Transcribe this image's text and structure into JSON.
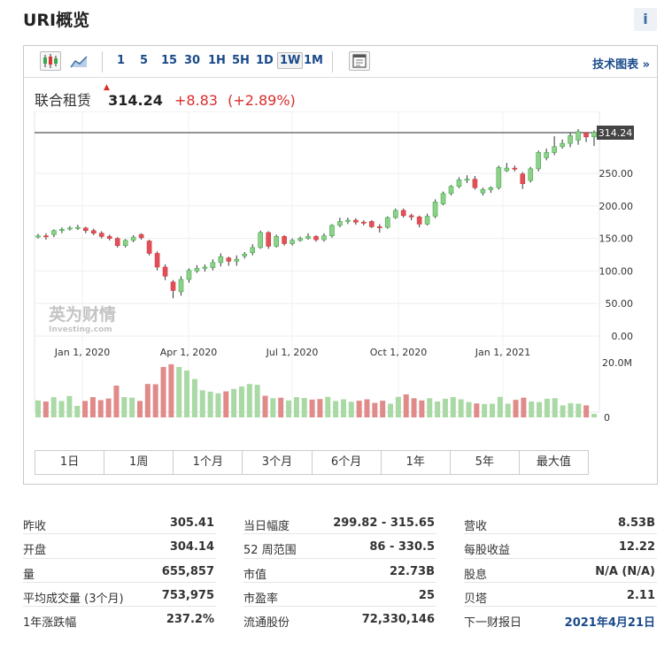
{
  "header": {
    "title": "URI概览",
    "info_icon": "i"
  },
  "toolbar": {
    "intervals": [
      "1",
      "5",
      "15",
      "30",
      "1H",
      "5H",
      "1D",
      "1W",
      "1M"
    ],
    "active_interval": "1W",
    "tech_chart_link": "技术图表 »"
  },
  "quote": {
    "name": "联合租赁",
    "price": "314.24",
    "change": "+8.83",
    "change_pct": "(+2.89%)"
  },
  "chart_data": {
    "type": "candlestick",
    "x_tick_labels": [
      "Jan 1, 2020",
      "Apr 1, 2020",
      "Jul 1, 2020",
      "Oct 1, 2020",
      "Jan 1, 2021"
    ],
    "y_tick_labels": [
      "250.00",
      "200.00",
      "150.00",
      "100.00",
      "50.00",
      "0.00"
    ],
    "ylim": [
      0,
      318
    ],
    "last_price_label": "314.24",
    "volume_axis_labels": [
      "20.0M",
      "0"
    ],
    "watermark": "英为财情 Investing.com",
    "colors": {
      "up": "#3fa94a",
      "down": "#d9383a",
      "up_fill": "#8fd18b",
      "down_fill": "#e0505a",
      "vol_up": "#a9d9a4",
      "vol_down": "#e08a8a"
    },
    "candles": [
      {
        "o": 152,
        "c": 154,
        "h": 157,
        "l": 150
      },
      {
        "o": 154,
        "c": 153,
        "h": 158,
        "l": 148
      },
      {
        "o": 156,
        "c": 162,
        "h": 164,
        "l": 152
      },
      {
        "o": 162,
        "c": 164,
        "h": 167,
        "l": 158
      },
      {
        "o": 165,
        "c": 166,
        "h": 169,
        "l": 162
      },
      {
        "o": 167,
        "c": 167,
        "h": 171,
        "l": 163
      },
      {
        "o": 166,
        "c": 162,
        "h": 168,
        "l": 158
      },
      {
        "o": 162,
        "c": 158,
        "h": 165,
        "l": 155
      },
      {
        "o": 158,
        "c": 153,
        "h": 161,
        "l": 150
      },
      {
        "o": 153,
        "c": 150,
        "h": 156,
        "l": 147
      },
      {
        "o": 150,
        "c": 139,
        "h": 152,
        "l": 136
      },
      {
        "o": 139,
        "c": 147,
        "h": 149,
        "l": 136
      },
      {
        "o": 147,
        "c": 152,
        "h": 155,
        "l": 144
      },
      {
        "o": 156,
        "c": 151,
        "h": 158,
        "l": 148
      },
      {
        "o": 146,
        "c": 127,
        "h": 148,
        "l": 124
      },
      {
        "o": 127,
        "c": 106,
        "h": 130,
        "l": 101
      },
      {
        "o": 106,
        "c": 92,
        "h": 110,
        "l": 86
      },
      {
        "o": 83,
        "c": 70,
        "h": 86,
        "l": 58
      },
      {
        "o": 68,
        "c": 87,
        "h": 92,
        "l": 62
      },
      {
        "o": 87,
        "c": 101,
        "h": 104,
        "l": 82
      },
      {
        "o": 100,
        "c": 104,
        "h": 109,
        "l": 97
      },
      {
        "o": 104,
        "c": 106,
        "h": 110,
        "l": 99
      },
      {
        "o": 105,
        "c": 113,
        "h": 118,
        "l": 101
      },
      {
        "o": 113,
        "c": 122,
        "h": 127,
        "l": 107
      },
      {
        "o": 120,
        "c": 115,
        "h": 122,
        "l": 108
      },
      {
        "o": 115,
        "c": 118,
        "h": 124,
        "l": 108
      },
      {
        "o": 123,
        "c": 126,
        "h": 129,
        "l": 119
      },
      {
        "o": 128,
        "c": 136,
        "h": 141,
        "l": 124
      },
      {
        "o": 136,
        "c": 159,
        "h": 162,
        "l": 134
      },
      {
        "o": 159,
        "c": 138,
        "h": 161,
        "l": 134
      },
      {
        "o": 138,
        "c": 153,
        "h": 156,
        "l": 136
      },
      {
        "o": 153,
        "c": 142,
        "h": 155,
        "l": 139
      },
      {
        "o": 142,
        "c": 147,
        "h": 150,
        "l": 139
      },
      {
        "o": 147,
        "c": 150,
        "h": 153,
        "l": 145
      },
      {
        "o": 150,
        "c": 153,
        "h": 158,
        "l": 148
      },
      {
        "o": 153,
        "c": 148,
        "h": 155,
        "l": 145
      },
      {
        "o": 148,
        "c": 154,
        "h": 158,
        "l": 145
      },
      {
        "o": 154,
        "c": 170,
        "h": 172,
        "l": 151
      },
      {
        "o": 170,
        "c": 176,
        "h": 182,
        "l": 167
      },
      {
        "o": 176,
        "c": 178,
        "h": 182,
        "l": 172
      },
      {
        "o": 178,
        "c": 175,
        "h": 181,
        "l": 171
      },
      {
        "o": 175,
        "c": 174,
        "h": 178,
        "l": 170
      },
      {
        "o": 176,
        "c": 168,
        "h": 178,
        "l": 166
      },
      {
        "o": 168,
        "c": 167,
        "h": 172,
        "l": 159
      },
      {
        "o": 167,
        "c": 182,
        "h": 184,
        "l": 165
      },
      {
        "o": 182,
        "c": 193,
        "h": 196,
        "l": 180
      },
      {
        "o": 193,
        "c": 185,
        "h": 196,
        "l": 182
      },
      {
        "o": 185,
        "c": 183,
        "h": 188,
        "l": 178
      },
      {
        "o": 183,
        "c": 172,
        "h": 185,
        "l": 167
      },
      {
        "o": 172,
        "c": 184,
        "h": 188,
        "l": 170
      },
      {
        "o": 184,
        "c": 206,
        "h": 210,
        "l": 181
      },
      {
        "o": 203,
        "c": 219,
        "h": 222,
        "l": 201
      },
      {
        "o": 219,
        "c": 230,
        "h": 232,
        "l": 216
      },
      {
        "o": 230,
        "c": 240,
        "h": 244,
        "l": 227
      },
      {
        "o": 240,
        "c": 241,
        "h": 247,
        "l": 235
      },
      {
        "o": 241,
        "c": 228,
        "h": 246,
        "l": 225
      },
      {
        "o": 220,
        "c": 225,
        "h": 228,
        "l": 216
      },
      {
        "o": 225,
        "c": 228,
        "h": 230,
        "l": 220
      },
      {
        "o": 228,
        "c": 259,
        "h": 262,
        "l": 225
      },
      {
        "o": 254,
        "c": 258,
        "h": 266,
        "l": 252
      },
      {
        "o": 258,
        "c": 257,
        "h": 262,
        "l": 253
      },
      {
        "o": 249,
        "c": 234,
        "h": 252,
        "l": 226
      },
      {
        "o": 239,
        "c": 257,
        "h": 260,
        "l": 236
      },
      {
        "o": 257,
        "c": 282,
        "h": 285,
        "l": 253
      },
      {
        "o": 274,
        "c": 282,
        "h": 288,
        "l": 270
      },
      {
        "o": 282,
        "c": 291,
        "h": 307,
        "l": 278
      },
      {
        "o": 291,
        "c": 296,
        "h": 302,
        "l": 288
      },
      {
        "o": 296,
        "c": 308,
        "h": 312,
        "l": 290
      },
      {
        "o": 301,
        "c": 314,
        "h": 318,
        "l": 294
      },
      {
        "o": 312,
        "c": 306,
        "h": 313,
        "l": 298
      },
      {
        "o": 306,
        "c": 313,
        "h": 316,
        "l": 292
      }
    ],
    "volumes": [
      6.2,
      5.8,
      7.4,
      6.0,
      7.8,
      4.2,
      6.0,
      7.4,
      6.3,
      6.9,
      11.6,
      7.4,
      7.2,
      6.0,
      12.2,
      12.1,
      18.4,
      19.4,
      18.4,
      17.1,
      14.0,
      9.9,
      9.4,
      8.8,
      9.5,
      10.4,
      11.3,
      12.2,
      11.9,
      7.9,
      7.0,
      7.2,
      6.2,
      7.4,
      7.1,
      6.5,
      6.7,
      7.5,
      6.0,
      6.6,
      5.7,
      6.1,
      6.6,
      5.3,
      6.1,
      5.0,
      7.5,
      8.4,
      7.0,
      6.2,
      7.0,
      5.8,
      6.8,
      7.4,
      6.6,
      5.6,
      5.1,
      4.9,
      5.0,
      7.5,
      5.0,
      6.4,
      7.2,
      5.8,
      5.6,
      6.8,
      7.0,
      4.4,
      5.2,
      5.0,
      4.4,
      1.3
    ]
  },
  "range_buttons": [
    "1日",
    "1周",
    "1个月",
    "3个月",
    "6个月",
    "1年",
    "5年",
    "最大值"
  ],
  "stats": {
    "col1": [
      {
        "label": "昨收",
        "value": "305.41"
      },
      {
        "label": "开盘",
        "value": "304.14"
      },
      {
        "label": "量",
        "value": "655,857"
      },
      {
        "label": "平均成交量 (3个月)",
        "value": "753,975"
      },
      {
        "label": "1年涨跌幅",
        "value": "237.2%"
      }
    ],
    "col2": [
      {
        "label": "当日幅度",
        "value": "299.82 - 315.65"
      },
      {
        "label": "52 周范围",
        "value": "86 - 330.5"
      },
      {
        "label": "市值",
        "value": "22.73B"
      },
      {
        "label": "市盈率",
        "value": "25"
      },
      {
        "label": "流通股份",
        "value": "72,330,146"
      }
    ],
    "col3": [
      {
        "label": "营收",
        "value": "8.53B"
      },
      {
        "label": "每股收益",
        "value": "12.22"
      },
      {
        "label": "股息",
        "value": "N/A (N/A)"
      },
      {
        "label": "贝塔",
        "value": "2.11"
      },
      {
        "label": "下一财报日",
        "value": "2021年4月21日"
      }
    ]
  }
}
